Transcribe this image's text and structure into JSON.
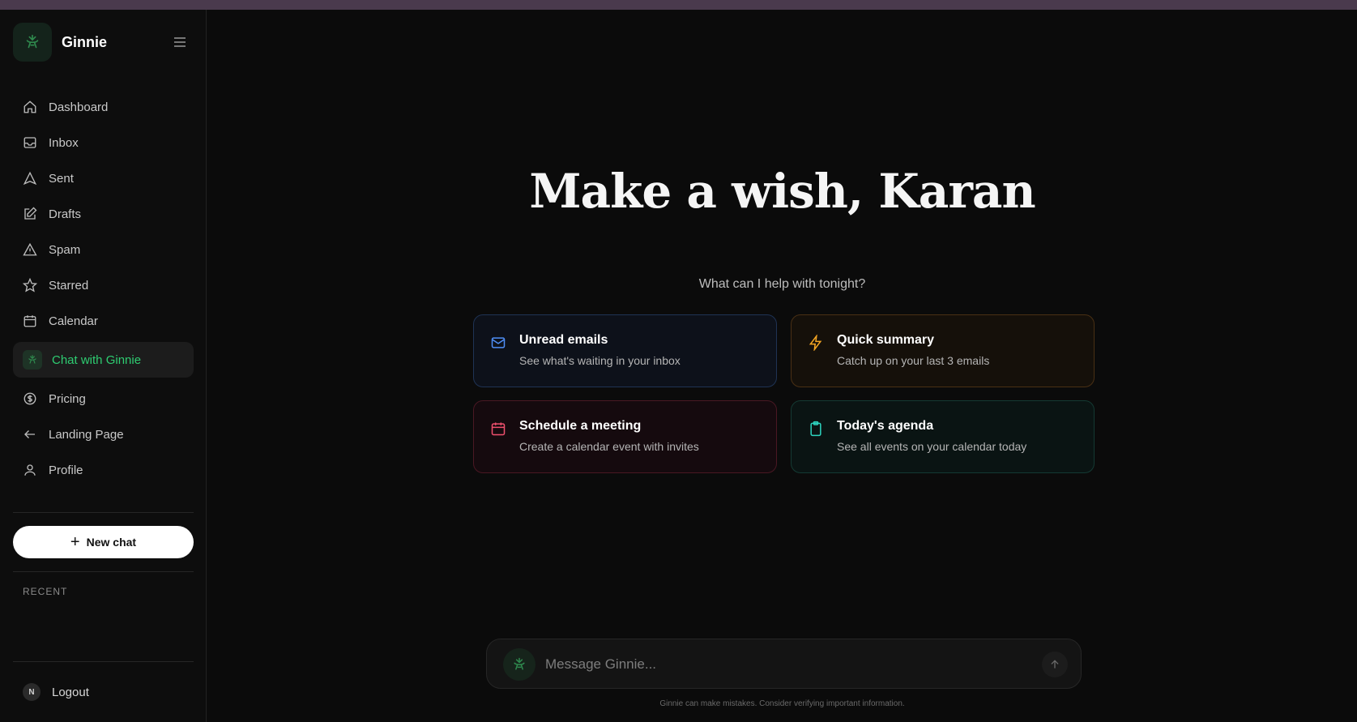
{
  "brand": {
    "name": "Ginnie"
  },
  "sidebar": {
    "items": [
      {
        "label": "Dashboard",
        "icon": "home-icon"
      },
      {
        "label": "Inbox",
        "icon": "inbox-icon"
      },
      {
        "label": "Sent",
        "icon": "send-icon"
      },
      {
        "label": "Drafts",
        "icon": "edit-icon"
      },
      {
        "label": "Spam",
        "icon": "warning-icon"
      },
      {
        "label": "Starred",
        "icon": "star-icon"
      },
      {
        "label": "Calendar",
        "icon": "calendar-icon"
      },
      {
        "label": "Chat with Ginnie",
        "icon": "ginnie-logo-icon",
        "active": true
      },
      {
        "label": "Pricing",
        "icon": "dollar-icon"
      },
      {
        "label": "Landing Page",
        "icon": "arrow-left-icon"
      },
      {
        "label": "Profile",
        "icon": "user-icon"
      }
    ],
    "new_chat_label": "New chat",
    "recent_label": "RECENT",
    "logout_label": "Logout",
    "avatar_initial": "N"
  },
  "main": {
    "hero_title": "Make a wish, Karan",
    "subtitle": "What can I help with tonight?",
    "cards": [
      {
        "title": "Unread emails",
        "desc": "See what's waiting in your inbox",
        "icon": "mail-icon",
        "color": "#4f8ff7"
      },
      {
        "title": "Quick summary",
        "desc": "Catch up on your last 3 emails",
        "icon": "lightning-icon",
        "color": "#f5a623"
      },
      {
        "title": "Schedule a meeting",
        "desc": "Create a calendar event with invites",
        "icon": "calendar-icon",
        "color": "#f0506e"
      },
      {
        "title": "Today's agenda",
        "desc": "See all events on your calendar today",
        "icon": "clipboard-icon",
        "color": "#2dd4bf"
      }
    ],
    "composer": {
      "placeholder": "Message Ginnie..."
    },
    "disclaimer": "Ginnie can make mistakes. Consider verifying important information."
  },
  "colors": {
    "accent": "#2ecc71",
    "background": "#0b0b0b"
  }
}
